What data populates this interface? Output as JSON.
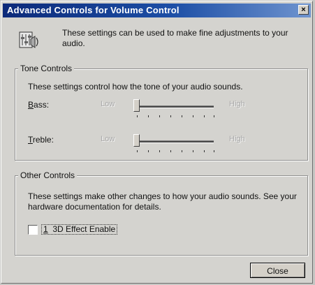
{
  "window": {
    "title": "Advanced Controls for Volume Control",
    "close_glyph": "×"
  },
  "header": {
    "icon": "audio-settings-icon",
    "intro": "These settings can be used to make fine adjustments to your audio."
  },
  "tone_controls": {
    "title": "Tone Controls",
    "description": "These settings control how the tone of your audio sounds.",
    "bass": {
      "label_ul": "B",
      "label_rest": "ass:",
      "low": "Low",
      "high": "High",
      "level": 0.0
    },
    "treble": {
      "label_ul": "T",
      "label_rest": "reble:",
      "low": "Low",
      "high": "High",
      "level": 0.0
    }
  },
  "other_controls": {
    "title": "Other Controls",
    "description": "These settings make other changes to how your audio sounds.  See your hardware documentation for details.",
    "effect": {
      "ul": "1",
      "rest": "  3D Effect Enable",
      "checked": false
    }
  },
  "buttons": {
    "close": "Close"
  }
}
